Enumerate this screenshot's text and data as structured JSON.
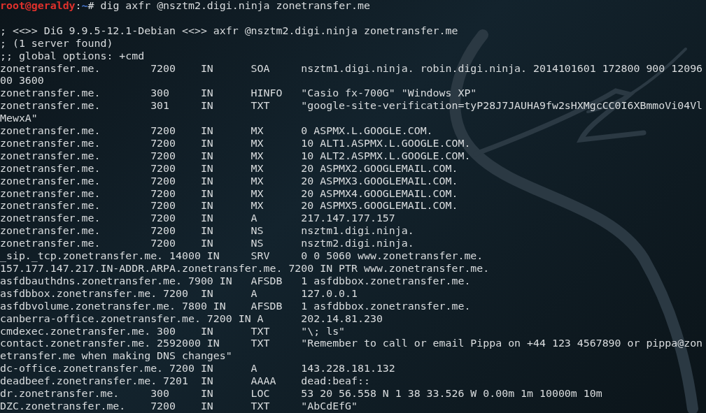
{
  "prompt": {
    "user_host": "root@geraldy",
    "separator": ":",
    "path": "~",
    "symbol": "#",
    "command": "dig axfr @nsztm2.digi.ninja zonetransfer.me"
  },
  "output": [
    "; <<>> DiG 9.9.5-12.1-Debian <<>> axfr @nsztm2.digi.ninja zonetransfer.me",
    "; (1 server found)",
    ";; global options: +cmd",
    "zonetransfer.me.        7200    IN      SOA     nsztm1.digi.ninja. robin.digi.ninja. 2014101601 172800 900 1209600 3600",
    "zonetransfer.me.        300     IN      HINFO   \"Casio fx-700G\" \"Windows XP\"",
    "zonetransfer.me.        301     IN      TXT     \"google-site-verification=tyP28J7JAUHA9fw2sHXMgcCC0I6XBmmoVi04VlMewxA\"",
    "zonetransfer.me.        7200    IN      MX      0 ASPMX.L.GOOGLE.COM.",
    "zonetransfer.me.        7200    IN      MX      10 ALT1.ASPMX.L.GOOGLE.COM.",
    "zonetransfer.me.        7200    IN      MX      10 ALT2.ASPMX.L.GOOGLE.COM.",
    "zonetransfer.me.        7200    IN      MX      20 ASPMX2.GOOGLEMAIL.COM.",
    "zonetransfer.me.        7200    IN      MX      20 ASPMX3.GOOGLEMAIL.COM.",
    "zonetransfer.me.        7200    IN      MX      20 ASPMX4.GOOGLEMAIL.COM.",
    "zonetransfer.me.        7200    IN      MX      20 ASPMX5.GOOGLEMAIL.COM.",
    "zonetransfer.me.        7200    IN      A       217.147.177.157",
    "zonetransfer.me.        7200    IN      NS      nsztm1.digi.ninja.",
    "zonetransfer.me.        7200    IN      NS      nsztm2.digi.ninja.",
    "_sip._tcp.zonetransfer.me. 14000 IN     SRV     0 0 5060 www.zonetransfer.me.",
    "157.177.147.217.IN-ADDR.ARPA.zonetransfer.me. 7200 IN PTR www.zonetransfer.me.",
    "asfdbauthdns.zonetransfer.me. 7900 IN   AFSDB   1 asfdbbox.zonetransfer.me.",
    "asfdbbox.zonetransfer.me. 7200  IN      A       127.0.0.1",
    "asfdbvolume.zonetransfer.me. 7800 IN    AFSDB   1 asfdbbox.zonetransfer.me.",
    "canberra-office.zonetransfer.me. 7200 IN A      202.14.81.230",
    "cmdexec.zonetransfer.me. 300    IN      TXT     \"\\; ls\"",
    "contact.zonetransfer.me. 2592000 IN     TXT     \"Remember to call or email Pippa on +44 123 4567890 or pippa@zonetransfer.me when making DNS changes\"",
    "dc-office.zonetransfer.me. 7200 IN      A       143.228.181.132",
    "deadbeef.zonetransfer.me. 7201  IN      AAAA    dead:beaf::",
    "dr.zonetransfer.me.     300     IN      LOC     53 20 56.558 N 1 38 33.526 W 0.00m 1m 10000m 10m",
    "DZC.zonetransfer.me.    7200    IN      TXT     \"AbCdEfG\""
  ]
}
